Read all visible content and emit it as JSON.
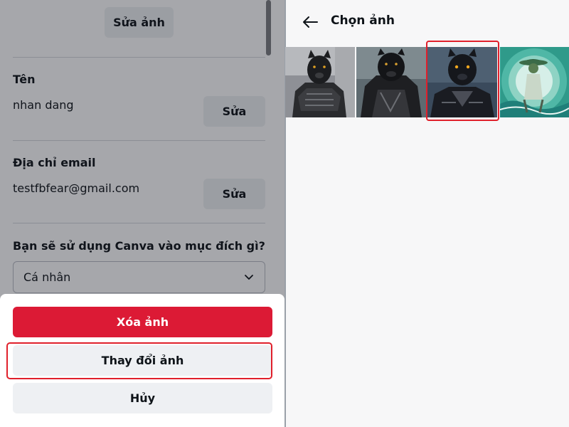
{
  "profile": {
    "edit_photo_label": "Sửa ảnh",
    "name": {
      "label": "Tên",
      "value": "nhan dang",
      "edit_label": "Sửa"
    },
    "email": {
      "label": "Địa chỉ email",
      "value": "testfbfear@gmail.com",
      "edit_label": "Sửa"
    },
    "purpose": {
      "question": "Bạn sẽ sử dụng Canva vào mục đích gì?",
      "selected": "Cá nhân"
    }
  },
  "photo_sheet": {
    "delete_label": "Xóa ảnh",
    "change_label": "Thay đổi ảnh",
    "cancel_label": "Hủy"
  },
  "picker": {
    "title": "Chọn ảnh",
    "back_icon": "arrow-left-icon",
    "selected_index": 2
  },
  "colors": {
    "danger": "#dc1a35",
    "highlight": "#e0202b",
    "button_bg": "#eef0f3"
  }
}
